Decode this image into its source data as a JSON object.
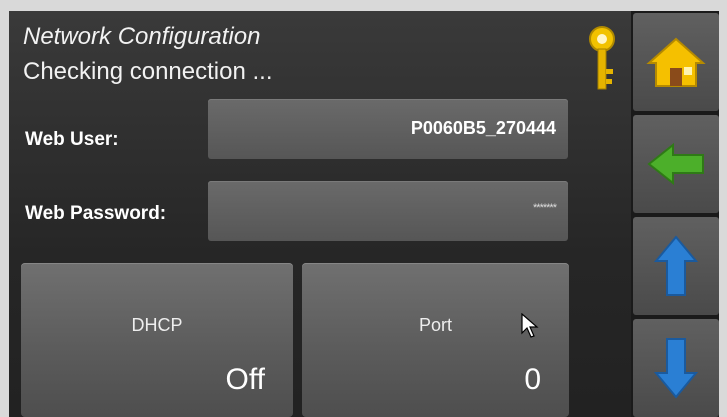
{
  "header": {
    "title": "Network Configuration",
    "status": "Checking connection ..."
  },
  "icons": {
    "key": "key-icon",
    "home": "home-icon",
    "back": "arrow-left-icon",
    "up": "arrow-up-icon",
    "down": "arrow-down-icon"
  },
  "form": {
    "web_user_label": "Web User:",
    "web_user_value": "P0060B5_270444",
    "web_password_label": "Web Password:",
    "web_password_value": "*******"
  },
  "tiles": {
    "dhcp_label": "DHCP",
    "dhcp_value": "Off",
    "port_label": "Port",
    "port_value": "0"
  },
  "colors": {
    "accent_yellow": "#f2c200",
    "back_green": "#4caf2a",
    "arrow_blue": "#2a7fd4"
  }
}
